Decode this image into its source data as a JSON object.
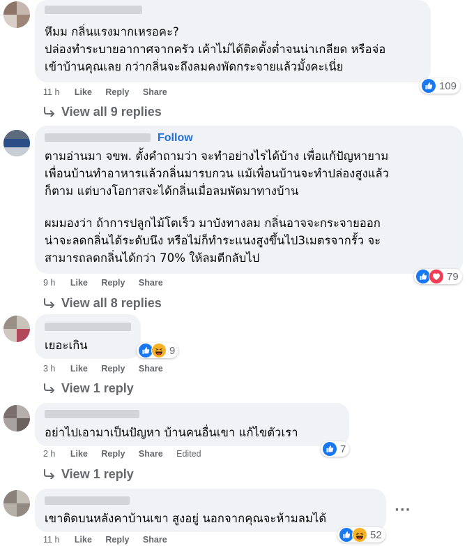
{
  "colors": {
    "bubble": "#f0f2f5",
    "muted": "#65676b",
    "link": "#216fdb",
    "like_blue": "#1877f2",
    "love_red": "#f33e58",
    "haha_yellow": "#f7b125"
  },
  "comments": [
    {
      "lines": [
        "หึมม กลิ่นแรงมากเหรอคะ?",
        "ปล่องทำระบายอากาศจากครัว เค้าไม่ได้ติดตั้งต่ำจนน่าเกลียด หรือจ่อ",
        "เข้าบ้านคุณเลย กว่ากลิ่นจะถึงลมคงพัดกระจายแล้วมั้งคะเนี่ย"
      ],
      "time": "11 h",
      "like": "Like",
      "reply": "Reply",
      "share": "Share",
      "reaction_icons": [
        "like-icon"
      ],
      "reaction_count": "109",
      "replies": "View all 9 replies"
    },
    {
      "follow": "Follow",
      "lines": [
        "ตามอ่านมา จขพ. ตั้งคำถามว่า จะทำอย่างไรได้บ้าง เพื่อแก้ปัญหายาม",
        "เพื่อนบ้านทำอาหารแล้วกลิ่นมารบกวน แม้เพื่อนบ้านจะทำปล่องสูงแล้ว",
        "ก็ตาม แต่บางโอกาสจะได้กลิ่นเมื่อลมพัดมาทางบ้าน"
      ],
      "lines2": [
        "ผมมองว่า ถ้าการปลูกไม้โตเร็ว มาบังทางลม กลิ่นอาจจะกระจายออก",
        "น่าจะลดกลิ่นได้ระดับนึง หรือไม่ก็ทำระแนงสูงขึ้นไป3เมตรจากรั้ว จะ",
        "สามารถลดกลิ่นได้กว่า 70% ให้ลมตีกลับไป"
      ],
      "time": "9 h",
      "like": "Like",
      "reply": "Reply",
      "share": "Share",
      "reaction_icons": [
        "like-icon",
        "love-icon"
      ],
      "reaction_count": "79",
      "replies": "View all 8 replies"
    },
    {
      "lines": [
        "เยอะเกิน"
      ],
      "time": "3 h",
      "like": "Like",
      "reply": "Reply",
      "share": "Share",
      "reaction_icons": [
        "like-icon",
        "haha-icon"
      ],
      "reaction_count": "9",
      "replies": "View 1 reply"
    },
    {
      "lines": [
        "อย่าไปเอามาเป็นปัญหา บ้านคนอื่นเขา แก้ไขตัวเรา"
      ],
      "time": "2 h",
      "like": "Like",
      "reply": "Reply",
      "share": "Share",
      "edited": "Edited",
      "reaction_icons": [
        "like-icon"
      ],
      "reaction_count": "7",
      "replies": "View 1 reply"
    },
    {
      "lines": [
        "เขาติดบนหลังคาบ้านเขา สูงอยู่ นอกจากคุณจะห้ามลมได้"
      ],
      "time": "11 h",
      "like": "Like",
      "reply": "Reply",
      "share": "Share",
      "reaction_icons": [
        "like-icon",
        "haha-icon"
      ],
      "reaction_count": "52",
      "more": "···"
    }
  ]
}
